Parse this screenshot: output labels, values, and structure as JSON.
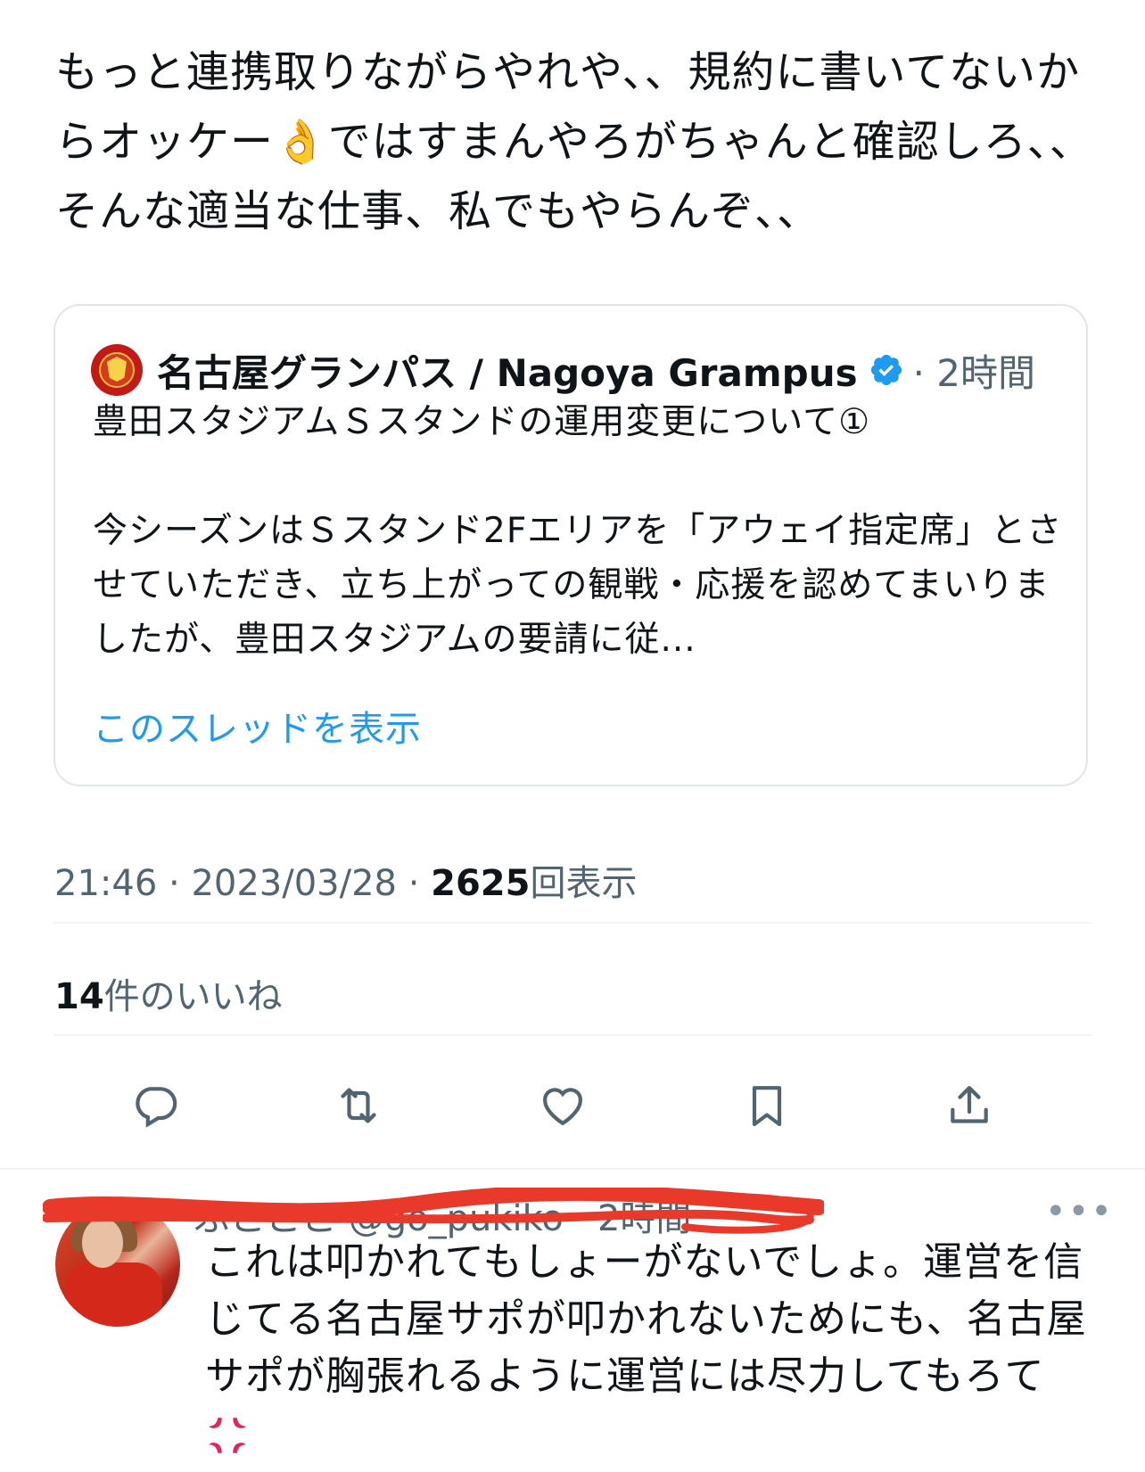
{
  "tweet": {
    "text": "もっと連携取りながらやれや、、規約に書いてないからオッケー👌ではすまんやろがちゃんと確認しろ、、そんな適当な仕事、私でもやらんぞ、、"
  },
  "quoted": {
    "name": "名古屋グランパス / Nagoya Grampus",
    "time": "· 2時間",
    "title": "豊田スタジアムＳスタンドの運用変更について①",
    "body": "今シーズンはＳスタンド2Fエリアを「アウェイ指定席」とさせていただき、立ち上がっての観戦・応援を認めてまいりましたが、豊田スタジアムの要請に従...",
    "show_thread": "このスレッドを表示"
  },
  "meta": {
    "time": "21:46",
    "sep1": " · ",
    "date": "2023/03/28",
    "sep2": " · ",
    "views_count": "2625",
    "views_label": "回表示"
  },
  "likes": {
    "count": "14",
    "label": "件のいいね"
  },
  "actions": {
    "icons": [
      "reply-icon",
      "retweet-icon",
      "like-icon",
      "bookmark-icon",
      "share-icon"
    ]
  },
  "reply": {
    "name_fragment": "ぷこここ @go_pukiko · 2時間",
    "more": "•••",
    "text": "これは叩かれてもしょーがないでしょ。運営を信じてる名古屋サポが叩かれないためにも、名古屋サポが胸張れるように運営には尽力してもろて",
    "emoji": "anger-icon"
  },
  "colors": {
    "text": "#0f1419",
    "secondary": "#536471",
    "link": "#1d9bf0",
    "border": "#e1e5e9",
    "redact": "#e8392b"
  }
}
